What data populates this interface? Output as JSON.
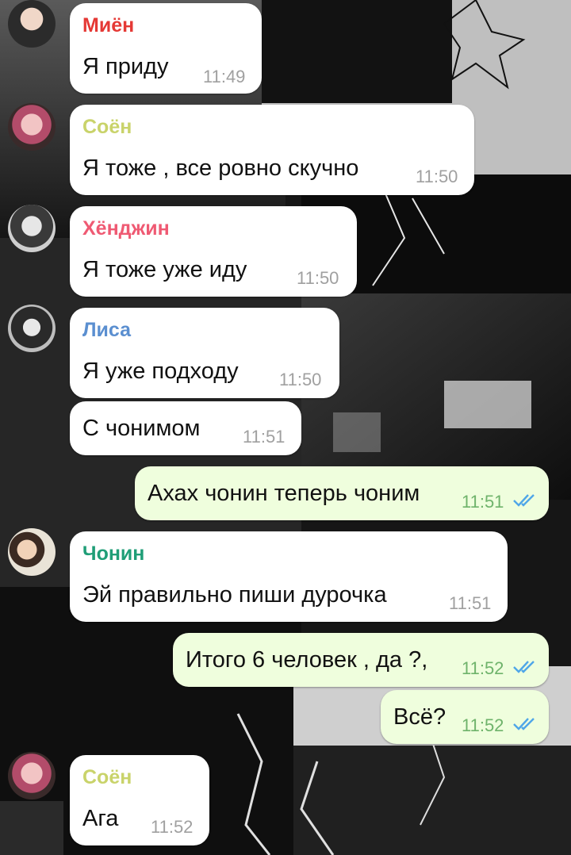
{
  "colors": {
    "incoming_bubble": "#ffffff",
    "outgoing_bubble": "#effedd",
    "time_in": "#a0a0a0",
    "time_out": "#6fb36b",
    "read_check": "#4fa6e8",
    "name_mien": "#e53935",
    "name_soen": "#c9d36a",
    "name_hyunjin": "#ef5a73",
    "name_lisa": "#5b8fd0",
    "name_chonin": "#1f9e77"
  },
  "messages": [
    {
      "sender": "Миён",
      "avatar": "avatar-girl-peace-sign",
      "text": "Я приду",
      "time": "11:49"
    },
    {
      "sender": "Соён",
      "avatar": "avatar-girl-pink",
      "text": "Я тоже , все ровно скучно",
      "time": "11:50"
    },
    {
      "sender": "Хёнджин",
      "avatar": "avatar-boy-hood",
      "text": "Я тоже уже иду",
      "time": "11:50"
    },
    {
      "sender": "Лиса",
      "avatar": "avatar-girl-bangs",
      "text": "Я уже подходу",
      "time": "11:50"
    },
    {
      "text": "С чонимом",
      "time": "11:51"
    },
    {
      "text": "Ахах чонин теперь чоним",
      "time": "11:51",
      "status": "read"
    },
    {
      "sender": "Чонин",
      "avatar": "avatar-boy-rabbit-hat",
      "text": "Эй правильно пиши дурочка",
      "time": "11:51"
    },
    {
      "text": "Итого 6 человек , да ?,",
      "time": "11:52",
      "status": "read"
    },
    {
      "text": "Всё?",
      "time": "11:52",
      "status": "read"
    },
    {
      "sender": "Соён",
      "avatar": "avatar-girl-pink",
      "text": "Ага",
      "time": "11:52"
    }
  ]
}
